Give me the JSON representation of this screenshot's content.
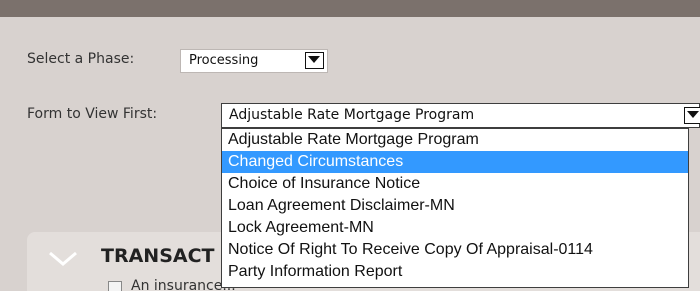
{
  "phase": {
    "label": "Select a Phase:",
    "selected": "Processing"
  },
  "form": {
    "label": "Form to View First:",
    "selected": "Adjustable Rate Mortgage Program",
    "options": [
      "Adjustable Rate Mortgage Program",
      "Changed Circumstances",
      "Choice of Insurance Notice",
      "Loan Agreement Disclaimer-MN",
      "Lock Agreement-MN",
      "Notice Of Right To Receive Copy Of Appraisal-0114",
      "Party Information Report"
    ],
    "highlighted_index": 1
  },
  "section": {
    "title": "TRANSACT",
    "body_text": "An insurance..."
  },
  "colors": {
    "top_bar": "#7b716c",
    "background": "#d8d2cf",
    "highlight": "#3399ff"
  },
  "icons": {
    "dropdown": "triangle-down",
    "section_toggle": "chevron-down"
  }
}
